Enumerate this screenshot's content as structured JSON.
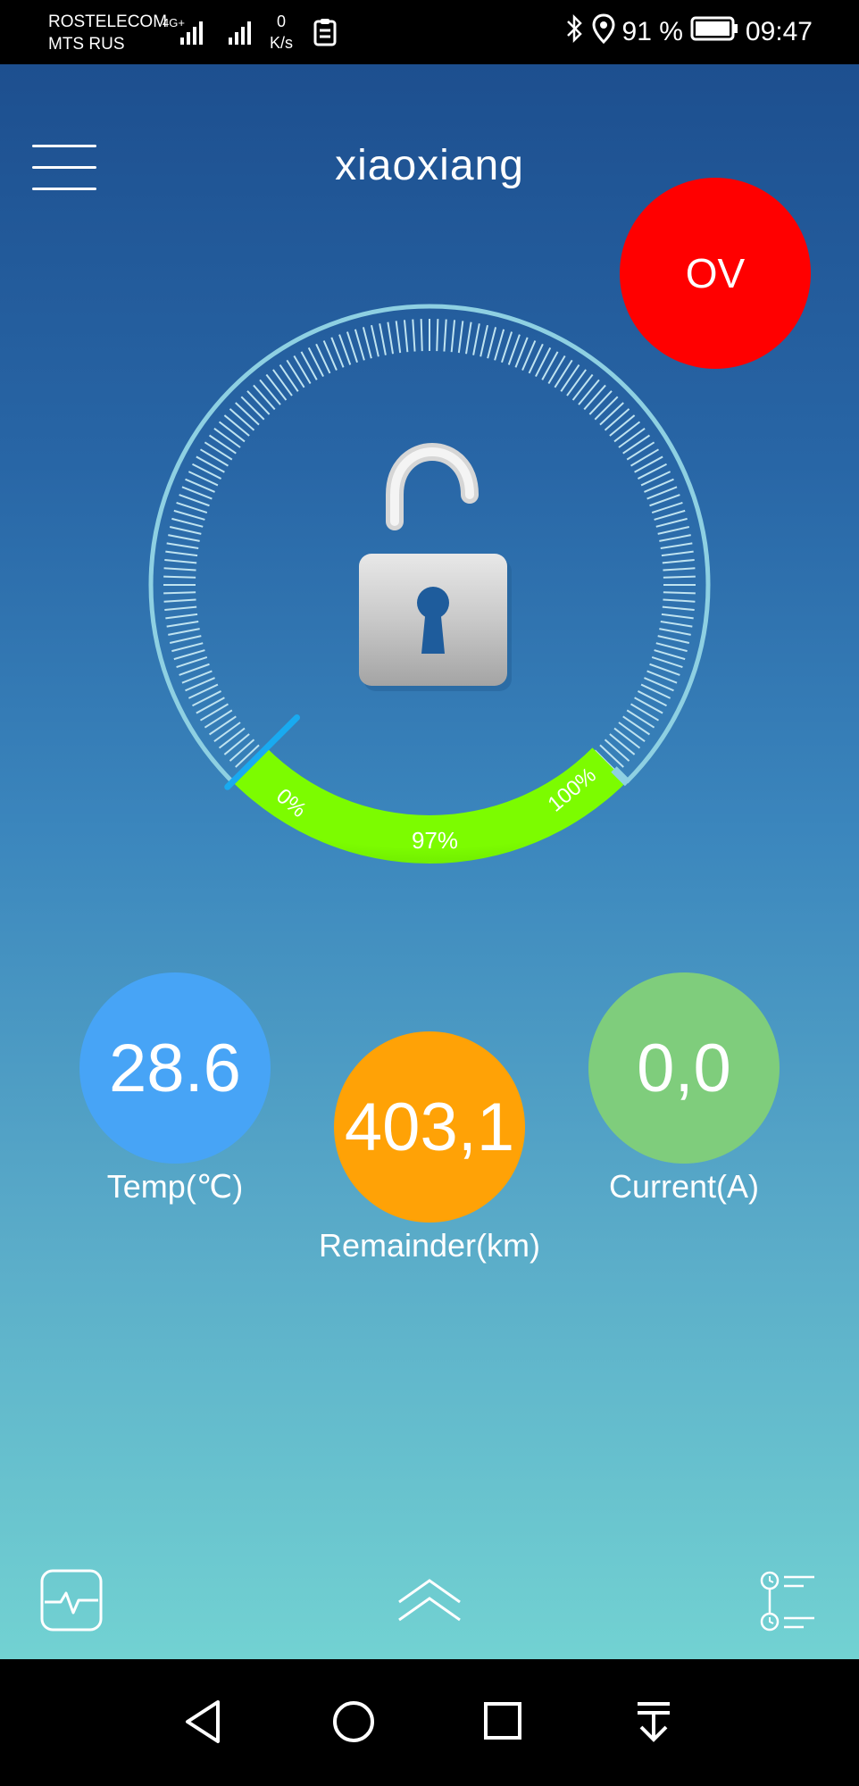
{
  "status_bar": {
    "carrier_1": "ROSTELECOM",
    "carrier_2": "MTS RUS",
    "network_type": "4G+",
    "speed_value": "0",
    "speed_unit": "K/s",
    "battery_percent": "91 %",
    "time": "09:47"
  },
  "header": {
    "title": "xiaoxiang",
    "alert_badge": "OV"
  },
  "gauge": {
    "lock_state": "unlocked",
    "charge_percent": 97,
    "charge_label": "97%",
    "min_label": "0%",
    "max_label": "100%"
  },
  "stats": {
    "temp": {
      "value": "28.6",
      "label": "Temp(℃)"
    },
    "remainder": {
      "value": "403,1",
      "label": "Remainder(km)"
    },
    "current": {
      "value": "0,0",
      "label": "Current(A)"
    }
  },
  "colors": {
    "alert": "#ff0000",
    "temp": "#47a4f6",
    "remainder": "#ffa206",
    "current": "#7fcd7c",
    "charge_bar": "#7cfc00"
  },
  "icons": {
    "menu": "hamburger-icon",
    "lock": "padlock-unlocked-icon",
    "left_bottom": "activity-monitor-icon",
    "center_bottom": "double-chevron-up-icon",
    "right_bottom": "timeline-list-icon"
  }
}
